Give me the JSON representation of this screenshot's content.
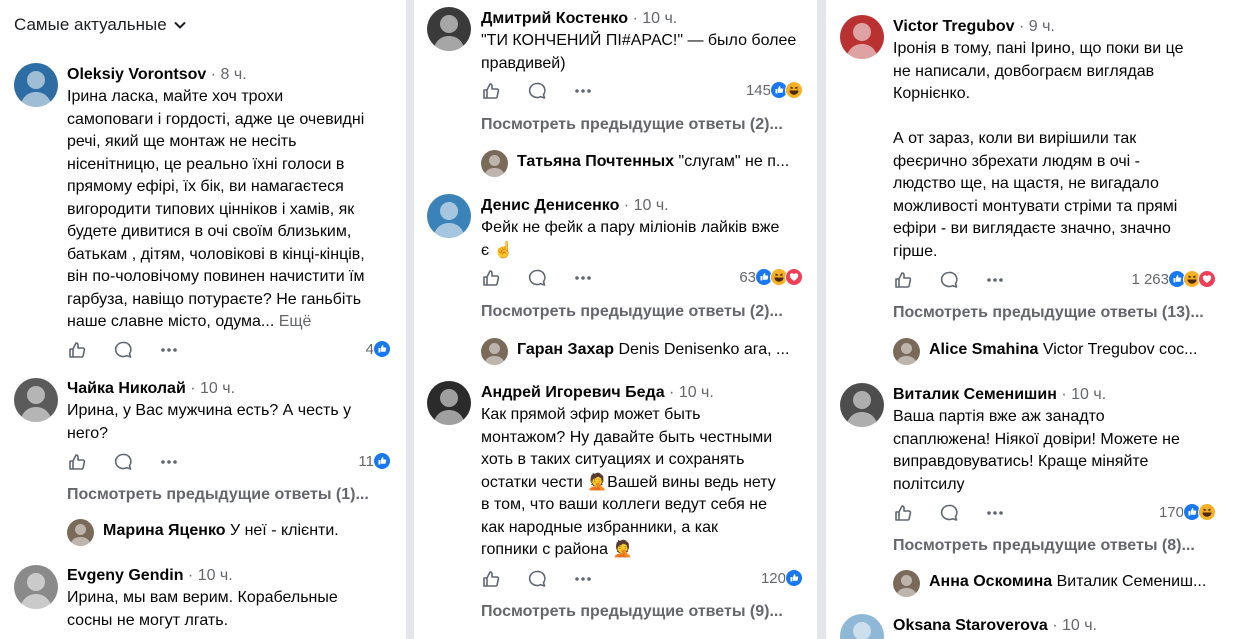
{
  "sort_label": "Самые актуальные",
  "colors": {
    "like": "#1877f2",
    "haha": "#f7b125",
    "love": "#f33e58",
    "muted": "#65676b"
  },
  "icons": {
    "like": "thumb-up-icon",
    "comment": "speech-bubble-icon",
    "more": "more-dots-icon",
    "sort": "chevron-down-icon"
  },
  "col1": {
    "c1": {
      "name": "Oleksiy Vorontsov",
      "time": " · 8 ч.",
      "text": "Ірина ласка, майте хоч трохи\nсамоповаги і гордості, адже це очевидні\nречі, який ще монтаж не несіть\nнісенітницю, це реально їхні голоси в\nпрямому ефірі, їх бік, ви намагаєтеся\nвигородити типових цінніков і хамів, як\nбудете дивитися в очі своїм близьким,\nбатькам , дітям, чоловікові в кінці-кінців,\nвін по-чоловічому повинен начистити їм\nгарбуза, навіщо потураєте? Не ганьбіть\nнаше славне місто, одума...",
      "more": " Ещё",
      "count": "4",
      "reactions": [
        "like"
      ]
    },
    "c2": {
      "name": "Чайка Николай",
      "time": " · 10 ч.",
      "text": "Ирина, у Вас мужчина есть? А честь у\nнего?",
      "count": "11",
      "reactions": [
        "like"
      ],
      "prev": "Посмотреть предыдущие ответы (1)...",
      "reply_name": "Марина Яценко",
      "reply_text": " У неї - клієнти."
    },
    "c3": {
      "name": "Evgeny Gendin",
      "time": " · 10 ч.",
      "text": "Ирина, мы вам верим. Корабельные\nсосны не могут лгать."
    }
  },
  "col2": {
    "c1": {
      "name": "Дмитрий Костенко",
      "time": " · 10 ч.",
      "text": "\"ТИ КОНЧЕНИЙ ПІ#АРАС!\" — было более\nправдивей)",
      "count": "145",
      "reactions": [
        "like",
        "haha"
      ],
      "prev": "Посмотреть предыдущие ответы (2)...",
      "reply_name": "Татьяна Почтенных",
      "reply_text": " \"слугам\" не п..."
    },
    "c2": {
      "name": "Денис Денисенко",
      "time": " · 10 ч.",
      "text": "Фейк не фейк а пару міліонів лайків вже\nє ☝",
      "count": "63",
      "reactions": [
        "like",
        "haha",
        "love"
      ],
      "prev": "Посмотреть предыдущие ответы (2)...",
      "reply_name": "Гаран Захар",
      "reply_text": " Denis  Denisenko ага, ..."
    },
    "c3": {
      "name": "Андрей Игоревич Беда",
      "time": " · 10 ч.",
      "text": "Как прямой эфир может быть\nмонтажом? Ну давайте быть честными\nхоть в таких ситуациях и сохранять\nостатки чести 🤦Вашей вины ведь нету\nв том, что ваши коллеги ведут себя не\nкак народные избранники, а как\nгопники с района 🤦",
      "count": "120",
      "reactions": [
        "like"
      ],
      "prev": "Посмотреть предыдущие ответы (9)..."
    }
  },
  "col3": {
    "c1": {
      "name": "Victor Tregubov",
      "time": " · 9 ч.",
      "text": "Іронія в тому, пані Ірино, що поки ви це\nне написали, довбограєм виглядав\nКорнієнко.\n\nА от зараз, коли ви вирішили так\nфеєрично збрехати людям в очі -\nлюдство ще, на щастя, не вигадало\nможливості монтувати стріми та прямі\nефіри - ви виглядаєте значно, значно\nгірше.",
      "count": "1 263",
      "reactions": [
        "like",
        "haha",
        "love"
      ],
      "prev": "Посмотреть предыдущие ответы (13)...",
      "reply_name": "Alice Smahina",
      "reply_text": " Victor Tregubov сос..."
    },
    "c2": {
      "name": "Виталик Семенишин",
      "time": " · 10 ч.",
      "text": "Ваша партія вже аж занадто\nспаплюжена! Ніякої довіри! Можете не\nвиправдовуватись! Краще міняйте\nполітсилу",
      "count": "170",
      "reactions": [
        "like",
        "haha"
      ],
      "prev": "Посмотреть предыдущие ответы (8)...",
      "reply_name": "Анна Оскомина",
      "reply_text": " Виталик Семениш..."
    },
    "c3": {
      "name": "Oksana Staroverova",
      "time": " · 10 ч."
    }
  }
}
